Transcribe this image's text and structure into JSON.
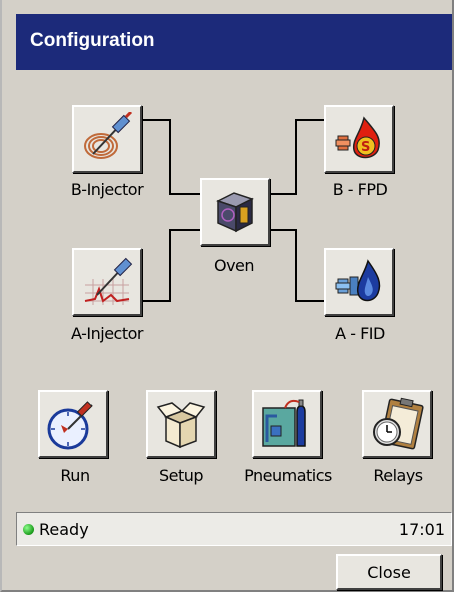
{
  "window": {
    "title": "Configuration"
  },
  "modules": {
    "b_injector": {
      "label": "B-Injector",
      "icon": "syringe-coil-icon"
    },
    "a_injector": {
      "label": "A-Injector",
      "icon": "syringe-chart-icon"
    },
    "oven": {
      "label": "Oven",
      "icon": "oven-cube-icon"
    },
    "b_fpd": {
      "label": "B - FPD",
      "icon": "flame-photometric-detector-icon"
    },
    "a_fid": {
      "label": "A - FID",
      "icon": "flame-ionization-detector-icon"
    }
  },
  "actions": [
    {
      "label": "Run",
      "icon": "run-gauge-icon"
    },
    {
      "label": "Setup",
      "icon": "open-box-icon"
    },
    {
      "label": "Pneumatics",
      "icon": "gas-cylinder-icon"
    },
    {
      "label": "Relays",
      "icon": "clipboard-clock-icon"
    }
  ],
  "status": {
    "text": "Ready",
    "time": "17:01",
    "indicator_color": "#1a9a1a"
  },
  "footer": {
    "close_label": "Close"
  },
  "colors": {
    "titlebar": "#1c2a7a",
    "background": "#d4d0c8"
  }
}
